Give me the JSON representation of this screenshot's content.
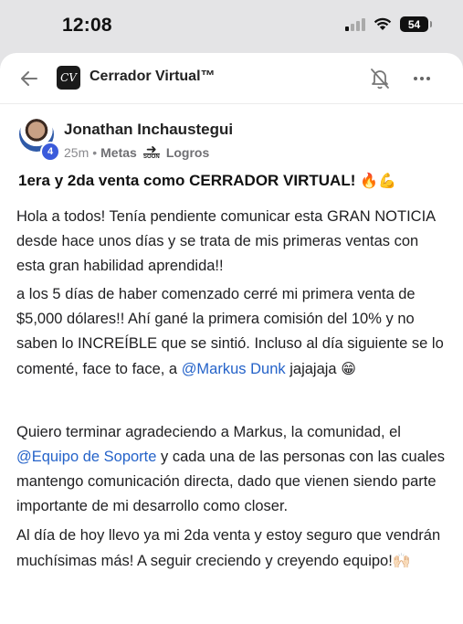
{
  "status_bar": {
    "time": "12:08",
    "battery": "54"
  },
  "header": {
    "logo_text": "CV",
    "title": "Cerrador Virtual™"
  },
  "post": {
    "author": "Jonathan Inchaustegui",
    "level": "4",
    "time_ago": "25m",
    "separator": "•",
    "category": "Metas",
    "category_icon_text": "SOON",
    "category_next": "Logros",
    "title": "1era y 2da venta como CERRADOR VIRTUAL!",
    "title_emoji": "🔥💪",
    "paragraphs": {
      "p1": "Hola a todos! Tenía pendiente comunicar esta GRAN NOTICIA desde hace unos días y se trata de mis primeras ventas con esta gran habilidad aprendida!!",
      "p2_before": "a los 5 días de haber comenzado cerré mi primera venta de $5,000 dólares!! Ahí gané la primera comisión del 10% y no saben lo INCREÍBLE que se sintió. Incluso al día siguiente se lo comenté, face to face, a ",
      "p2_mention": "@Markus Dunk",
      "p2_after": " jajajaja",
      "p2_emoji": "😁",
      "p3_before": "Quiero terminar agradeciendo a Markus, la comunidad, el ",
      "p3_mention": "@Equipo de Soporte",
      "p3_after": " y cada una de las personas con las cuales mantengo comunicación directa, dado que vienen siendo parte importante de mi desarrollo como closer.",
      "p4": "Al día de hoy llevo ya mi 2da venta y estoy seguro que vendrán muchísimas más! A seguir creciendo y creyendo equipo!",
      "p4_emoji": "🙌🏻"
    }
  },
  "colors": {
    "mention": "#2563c9",
    "badge": "#3b5bdb"
  }
}
